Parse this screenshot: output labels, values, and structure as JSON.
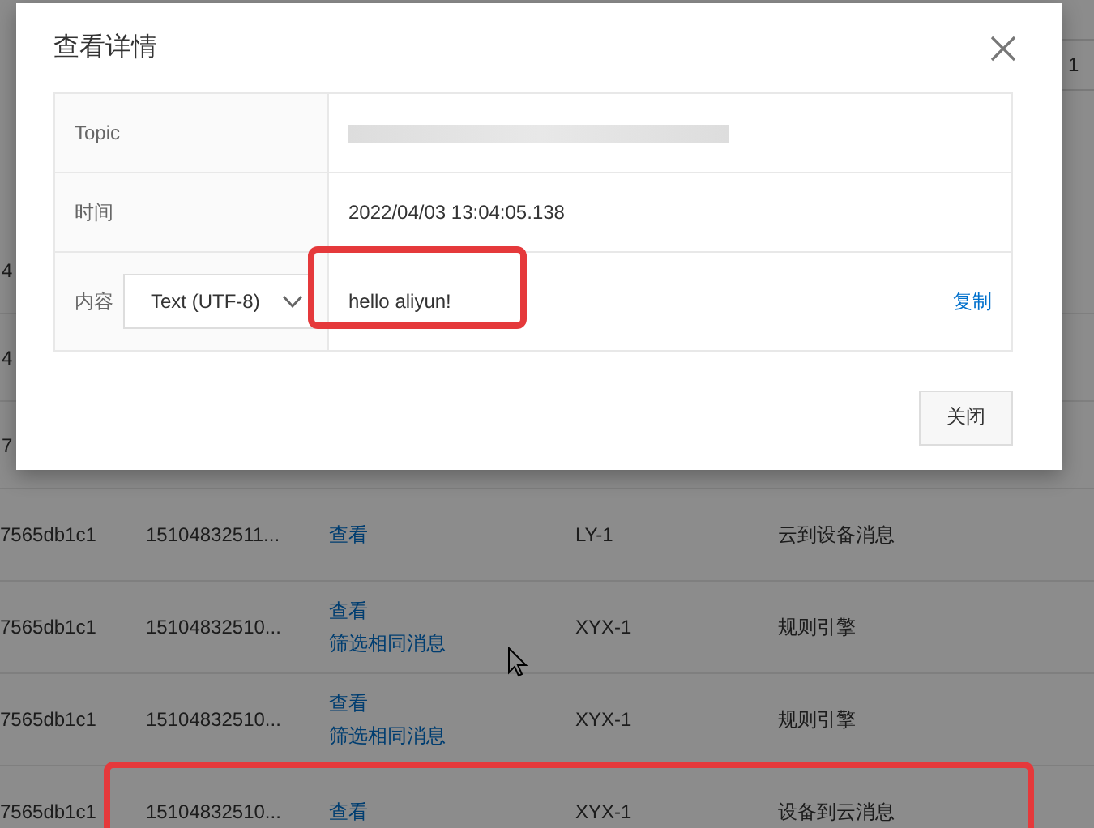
{
  "background_table": {
    "top_fragment": "1",
    "partial_rows": [
      "4",
      "4",
      "7"
    ],
    "rows": [
      {
        "column_1": "7565db1c1",
        "column_2": "15104832511...",
        "links": [
          "查看"
        ],
        "column_4": "LY-1",
        "column_5": "云到设备消息",
        "highlighted": false
      },
      {
        "column_1": "7565db1c1",
        "column_2": "15104832510...",
        "links": [
          "查看",
          "筛选相同消息"
        ],
        "column_4": "XYX-1",
        "column_5": "规则引擎",
        "highlighted": false
      },
      {
        "column_1": "7565db1c1",
        "column_2": "15104832510...",
        "links": [
          "查看",
          "筛选相同消息"
        ],
        "column_4": "XYX-1",
        "column_5": "规则引擎",
        "highlighted": false
      },
      {
        "column_1": "7565db1c1",
        "column_2": "15104832510...",
        "links": [
          "查看"
        ],
        "column_4": "XYX-1",
        "column_5": "设备到云消息",
        "highlighted": true
      }
    ]
  },
  "dialog": {
    "title": "查看详情",
    "fields": [
      {
        "kind": "redacted",
        "label": "Topic"
      },
      {
        "kind": "text",
        "label": "时间",
        "value": "2022/04/03 13:04:05.138"
      },
      {
        "kind": "content",
        "label": "内容",
        "format": "Text (UTF-8)",
        "value": "hello aliyun!",
        "action": "复制",
        "highlighted": true
      }
    ],
    "buttons": [
      "关闭"
    ]
  }
}
